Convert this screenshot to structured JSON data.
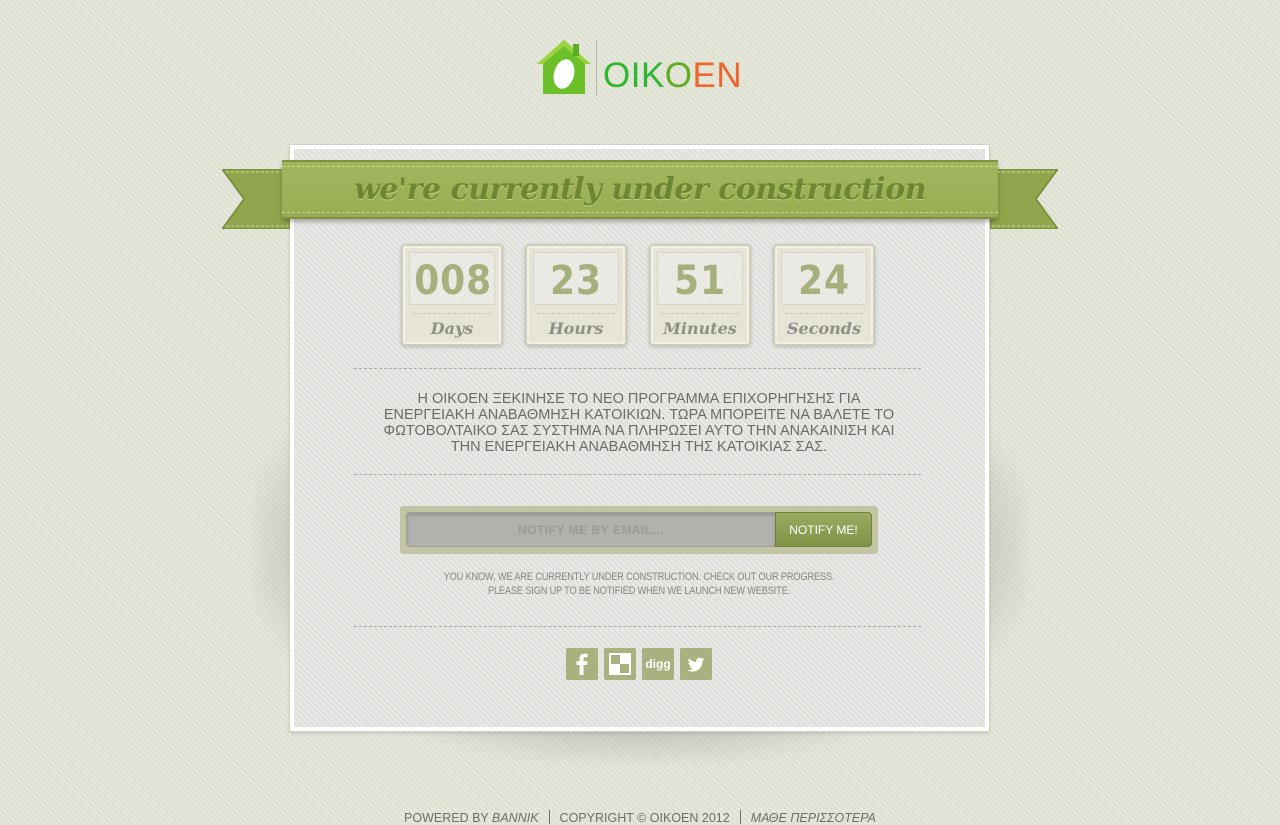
{
  "logo": {
    "text_part1": "OIK",
    "text_part2": "O",
    "text_part3": "EN"
  },
  "ribbon": {
    "title": "we're currently under construction"
  },
  "countdown": [
    {
      "value": "008",
      "label": "Days"
    },
    {
      "value": "23",
      "label": "Hours"
    },
    {
      "value": "51",
      "label": "Minutes"
    },
    {
      "value": "24",
      "label": "Seconds"
    }
  ],
  "announcement": "Η OIKOEN ΞΕΚΙΝΗΣΕ ΤΟ ΝΕΟ ΠΡΟΓΡΑΜΜΑ ΕΠΙΧΟΡΗΓΗΣΗΣ ΓΙΑ ΕΝΕΡΓΕΙΑΚΗ ΑΝΑΒΑΘΜΗΣΗ ΚΑΤΟΙΚΙΩΝ. ΤΩΡΑ ΜΠΟΡΕΙΤΕ ΝΑ ΒΑΛΕΤΕ ΤΟ ΦΩΤΟΒΟΛΤΑΙΚΟ ΣΑΣ ΣΥΣΤΗΜΑ ΝΑ ΠΛΗΡΩΣΕΙ ΑΥΤΟ ΤΗΝ ΑΝΑΚΑΙΝΙΣΗ ΚΑΙ ΤΗΝ ΕΝΕΡΓΕΙΑΚΗ ΑΝΑΒΑΘΜΗΣΗ ΤΗΣ ΚΑΤΟΙΚΙΑΣ ΣΑΣ.",
  "notify": {
    "placeholder": "NOTIFY ME BY EMAIL...",
    "button_label": "NOTIFY ME!",
    "note": "YOU KNOW, WE ARE CURRENTLY UNDER CONSTRUCTION. CHECK OUT OUR PROGRESS. PLEASE SIGN UP TO BE NOTIFIED WHEN WE LAUNCH NEW WEBSITE."
  },
  "social": [
    {
      "name": "facebook-icon"
    },
    {
      "name": "delicious-icon"
    },
    {
      "name": "digg-icon",
      "label": "digg"
    },
    {
      "name": "twitter-icon"
    }
  ],
  "footer": {
    "powered_prefix": "POWERED BY ",
    "powered_name": "BANNIK",
    "copyright": "COPYRIGHT © OIKOEN 2012",
    "learn_more": "ΜΑΘΕ ΠΕΡΙΣΣΟΤΕΡΑ"
  },
  "colors": {
    "accent_green": "#9cb158",
    "counter_digits": "#a6b07d",
    "logo_orange": "#f0662a"
  }
}
